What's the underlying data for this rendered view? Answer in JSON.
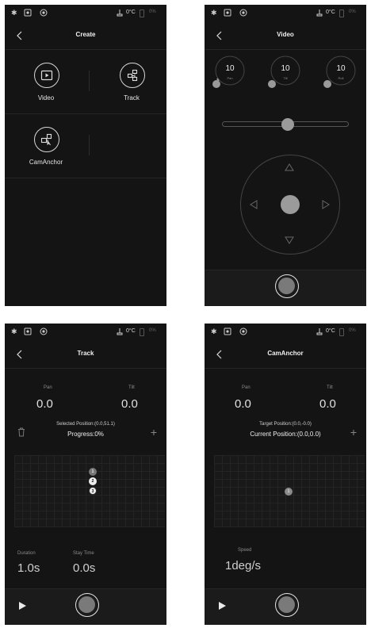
{
  "status": {
    "temperature": "0°C",
    "battery_pct": "0%"
  },
  "screens": {
    "create": {
      "title": "Create",
      "tiles": [
        {
          "label": "Video",
          "icon": "video-icon"
        },
        {
          "label": "Track",
          "icon": "track-icon"
        },
        {
          "label": "CamAnchor",
          "icon": "camanchor-icon"
        }
      ]
    },
    "video": {
      "title": "Video",
      "dials": [
        {
          "value": "10",
          "label": "Pan"
        },
        {
          "value": "10",
          "label": "Tilt"
        },
        {
          "value": "10",
          "label": "Roll"
        }
      ],
      "slider_level": 0.52
    },
    "track": {
      "title": "Track",
      "pan_label": "Pan",
      "pan_value": "0.0",
      "tilt_label": "Tilt",
      "tilt_value": "0.0",
      "selected_position": "Selected Position:(0.0,51.1)",
      "progress": "Progress:0%",
      "keypoints": [
        "1",
        "2",
        "3"
      ],
      "duration_label": "Duration",
      "duration_value": "1.0s",
      "stay_label": "Stay Time",
      "stay_value": "0.0s"
    },
    "camanchor": {
      "title": "CamAnchor",
      "pan_label": "Pan",
      "pan_value": "0.0",
      "tilt_label": "Tilt",
      "tilt_value": "0.0",
      "target_position": "Target Position:(0.0,-0.0)",
      "current_position": "Current Position:(0.0,0.0)",
      "marker": "1",
      "speed_label": "Speed",
      "speed_value": "1deg/s"
    }
  },
  "colors": {
    "background": "#141414",
    "accent_gray": "#9a9a9a"
  }
}
